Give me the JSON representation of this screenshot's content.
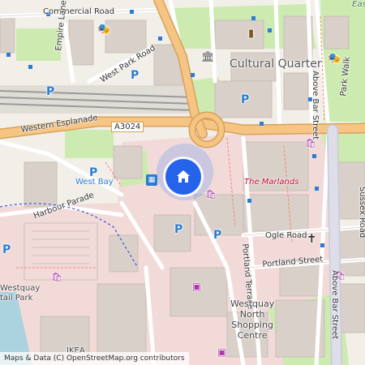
{
  "map": {
    "streets": {
      "commercial_road": "Commercial Road",
      "empire_lane": "Empire Lane",
      "west_park_road": "West Park Road",
      "western_esplanade": "Western Esplanade",
      "a3024": "A3024",
      "harbour_parade": "Harbour Parade",
      "ogle_road": "Ogle Road",
      "portland_street": "Portland Street",
      "portland_terrace": "Portland Terrace",
      "above_bar_street_top": "Above Bar Street",
      "above_bar_street_bottom": "Above Bar Street",
      "park_walk": "Park Walk",
      "sussex_road": "Sussex Road",
      "east": "East"
    },
    "places": {
      "cultural_quarter": "Cultural Quarter",
      "the_marlands": "The Marlands",
      "west_bay": "West Bay",
      "westquay_north_line1": "Westquay",
      "westquay_north_line2": "North",
      "westquay_north_line3": "Shopping",
      "westquay_north_line4": "Centre",
      "retail_park_line1": "Westquay",
      "retail_park_line2": "tail Park",
      "ikea": "IKEA"
    },
    "parking_symbol": "P",
    "attribution": "Maps & Data (C) OpenStreetMap.org contributors",
    "colors": {
      "road_major": "#f7c583",
      "road_minor": "#ffffff",
      "park": "#cdebb0",
      "building": "#d9d0c9",
      "commercial": "#f2dad9",
      "water": "#aad3df",
      "marker": "#2563eb",
      "parking": "#2b7cd3",
      "retail_text": "#c3002f"
    }
  }
}
